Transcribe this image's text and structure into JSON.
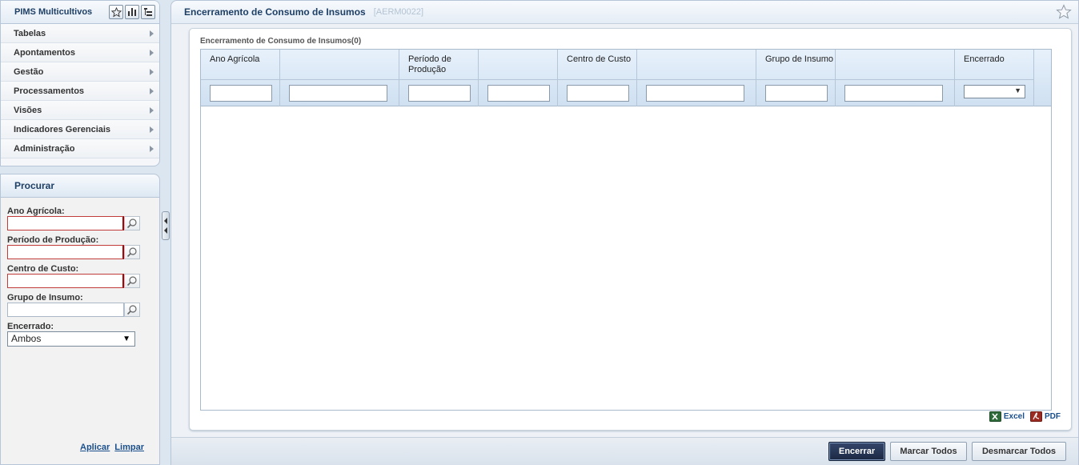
{
  "menu": {
    "title": "PIMS Multicultivos",
    "items": [
      {
        "label": "Tabelas"
      },
      {
        "label": "Apontamentos"
      },
      {
        "label": "Gestão"
      },
      {
        "label": "Processamentos"
      },
      {
        "label": "Visões"
      },
      {
        "label": "Indicadores Gerenciais"
      },
      {
        "label": "Administração"
      }
    ]
  },
  "search": {
    "title": "Procurar",
    "fields": [
      {
        "label": "Ano Agrícola:",
        "value": ""
      },
      {
        "label": "Período de Produção:",
        "value": ""
      },
      {
        "label": "Centro de Custo:",
        "value": ""
      },
      {
        "label": "Grupo de Insumo:",
        "value": ""
      }
    ],
    "encerrado": {
      "label": "Encerrado:",
      "selected": "Ambos"
    },
    "apply_label": "Aplicar",
    "clear_label": "Limpar"
  },
  "main": {
    "title": "Encerramento de Consumo de Insumos",
    "code": "[AERM0022]",
    "grid": {
      "caption": "Encerramento de Consumo de Insumos(0)",
      "columns": [
        {
          "title": "Ano Agrícola"
        },
        {
          "title": ""
        },
        {
          "title": "Período de Produção"
        },
        {
          "title": ""
        },
        {
          "title": "Centro de Custo"
        },
        {
          "title": ""
        },
        {
          "title": "Grupo de Insumo"
        },
        {
          "title": ""
        },
        {
          "title": "Encerrado"
        }
      ],
      "encerrado_filter": ""
    },
    "export": {
      "excel": "Excel",
      "pdf": "PDF"
    },
    "buttons": {
      "encerrar": "Encerrar",
      "marcar": "Marcar Todos",
      "desmarcar": "Desmarcar Todos"
    }
  },
  "colors": {
    "header_text": "#1e3f66",
    "primary_button": "#1b2843",
    "required_border": "#b00000",
    "link": "#1a4f8b"
  }
}
